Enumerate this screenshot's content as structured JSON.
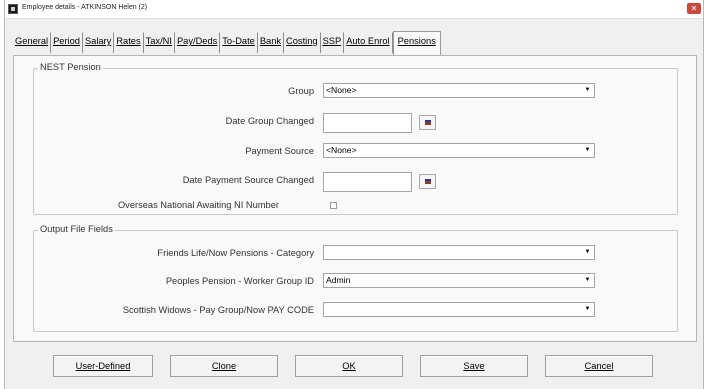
{
  "window": {
    "title": "Employee details - ATKINSON Helen (2)",
    "close_glyph": "✕"
  },
  "tabs": [
    {
      "label": "General",
      "active": false
    },
    {
      "label": "Period",
      "active": false
    },
    {
      "label": "Salary",
      "active": false
    },
    {
      "label": "Rates",
      "active": false
    },
    {
      "label": "Tax/NI",
      "active": false
    },
    {
      "label": "Pay/Deds",
      "active": false
    },
    {
      "label": "To-Date",
      "active": false
    },
    {
      "label": "Bank",
      "active": false
    },
    {
      "label": "Costing",
      "active": false
    },
    {
      "label": "SSP",
      "active": false
    },
    {
      "label": "Auto Enrol",
      "active": false
    },
    {
      "label": "Pensions",
      "active": true
    }
  ],
  "nest": {
    "legend": "NEST Pension",
    "group_label": "Group",
    "group_value": "<None>",
    "date_group_changed_label": "Date Group Changed",
    "date_group_changed_value": "",
    "payment_source_label": "Payment Source",
    "payment_source_value": "<None>",
    "date_payment_source_changed_label": "Date Payment Source Changed",
    "date_payment_source_changed_value": "",
    "overseas_label": "Overseas National Awaiting NI Number",
    "overseas_checked": false
  },
  "output": {
    "legend": "Output File Fields",
    "friends_life_label": "Friends Life/Now Pensions - Category",
    "friends_life_value": "",
    "peoples_pension_label": "Peoples Pension - Worker Group ID",
    "peoples_pension_value": "Admin",
    "scottish_widows_label": "Scottish Widows - Pay Group/Now PAY CODE",
    "scottish_widows_value": ""
  },
  "buttons": {
    "user_defined": "User-Defined",
    "clone": "Clone",
    "ok": "OK",
    "save": "Save",
    "cancel": "Cancel"
  },
  "icons": {
    "dropdown": "▼",
    "calendar": "calendar-icon"
  }
}
